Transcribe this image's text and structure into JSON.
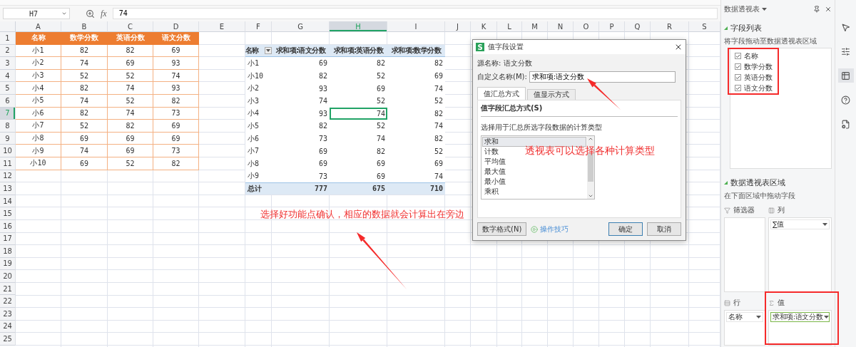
{
  "formula_bar": {
    "cell_ref": "H7",
    "fx": "fx",
    "value": "74"
  },
  "sheet": {
    "columns": [
      {
        "label": "A",
        "selected": false
      },
      {
        "label": "B",
        "selected": false
      },
      {
        "label": "C",
        "selected": false
      },
      {
        "label": "D",
        "selected": false
      },
      {
        "label": "E",
        "selected": false
      },
      {
        "label": "F",
        "selected": false
      },
      {
        "label": "G",
        "selected": false
      },
      {
        "label": "H",
        "selected": true
      },
      {
        "label": "I",
        "selected": false
      },
      {
        "label": "J",
        "selected": false
      },
      {
        "label": "K",
        "selected": false
      },
      {
        "label": "L",
        "selected": false
      },
      {
        "label": "M",
        "selected": false
      },
      {
        "label": "N",
        "selected": false
      },
      {
        "label": "O",
        "selected": false
      },
      {
        "label": "P",
        "selected": false
      },
      {
        "label": "Q",
        "selected": false
      },
      {
        "label": "R",
        "selected": false
      },
      {
        "label": "S",
        "selected": false
      }
    ],
    "rows": [
      {
        "label": "1",
        "selected": false
      },
      {
        "label": "2",
        "selected": false
      },
      {
        "label": "3",
        "selected": false
      },
      {
        "label": "4",
        "selected": false
      },
      {
        "label": "5",
        "selected": false
      },
      {
        "label": "6",
        "selected": false
      },
      {
        "label": "7",
        "selected": true
      },
      {
        "label": "8",
        "selected": false
      },
      {
        "label": "9",
        "selected": false
      },
      {
        "label": "10",
        "selected": false
      },
      {
        "label": "11",
        "selected": false
      },
      {
        "label": "12",
        "selected": false
      },
      {
        "label": "13",
        "selected": false
      },
      {
        "label": "14",
        "selected": false
      },
      {
        "label": "15",
        "selected": false
      },
      {
        "label": "16",
        "selected": false
      },
      {
        "label": "17",
        "selected": false
      },
      {
        "label": "18",
        "selected": false
      },
      {
        "label": "19",
        "selected": false
      },
      {
        "label": "20",
        "selected": false
      },
      {
        "label": "21",
        "selected": false
      },
      {
        "label": "22",
        "selected": false
      },
      {
        "label": "23",
        "selected": false
      },
      {
        "label": "24",
        "selected": false
      },
      {
        "label": "25",
        "selected": false
      }
    ],
    "source_table": {
      "header": [
        "名称",
        "数学分数",
        "英语分数",
        "语文分数"
      ],
      "rows": [
        [
          "小1",
          "82",
          "82",
          "69"
        ],
        [
          "小2",
          "74",
          "69",
          "93"
        ],
        [
          "小3",
          "52",
          "52",
          "74"
        ],
        [
          "小4",
          "82",
          "74",
          "93"
        ],
        [
          "小5",
          "74",
          "52",
          "82"
        ],
        [
          "小6",
          "82",
          "74",
          "73"
        ],
        [
          "小7",
          "52",
          "82",
          "69"
        ],
        [
          "小8",
          "69",
          "69",
          "69"
        ],
        [
          "小9",
          "74",
          "69",
          "73"
        ],
        [
          "小10",
          "69",
          "52",
          "82"
        ]
      ]
    },
    "pivot_table": {
      "header": [
        "名称",
        "求和项:语文分数",
        "求和项:英语分数",
        "求和项:数学分数"
      ],
      "rows": [
        [
          "小1",
          "69",
          "82",
          "82"
        ],
        [
          "小10",
          "82",
          "52",
          "69"
        ],
        [
          "小2",
          "93",
          "69",
          "74"
        ],
        [
          "小3",
          "74",
          "52",
          "52"
        ],
        [
          "小4",
          "93",
          "74",
          "82"
        ],
        [
          "小5",
          "82",
          "52",
          "74"
        ],
        [
          "小6",
          "73",
          "74",
          "82"
        ],
        [
          "小7",
          "69",
          "82",
          "52"
        ],
        [
          "小8",
          "69",
          "69",
          "69"
        ],
        [
          "小9",
          "73",
          "69",
          "74"
        ]
      ],
      "total": [
        "总计",
        "777",
        "675",
        "710"
      ]
    }
  },
  "dialog": {
    "app_icon_letter": "S",
    "title": "值字段设置",
    "source_name": "源名称: 语文分数",
    "custom_name_label": "自定义名称(M):",
    "custom_name_value": "求和项:语文分数",
    "tabs": [
      {
        "label": "值汇总方式",
        "selected": true
      },
      {
        "label": "值显示方式",
        "selected": false
      }
    ],
    "section_title": "值字段汇总方式(S)",
    "hint": "选择用于汇总所选字段数据的计算类型",
    "options": [
      {
        "label": "求和",
        "selected": true
      },
      {
        "label": "计数",
        "selected": false
      },
      {
        "label": "平均值",
        "selected": false
      },
      {
        "label": "最大值",
        "selected": false
      },
      {
        "label": "最小值",
        "selected": false
      },
      {
        "label": "乘积",
        "selected": false
      }
    ],
    "number_format_button": "数字格式(N)",
    "tips_link": "操作技巧",
    "ok_button": "确定",
    "cancel_button": "取消"
  },
  "pivot_panel": {
    "title": "数据透视表",
    "field_list_title": "字段列表",
    "field_list_hint": "将字段拖动至数据透视表区域",
    "fields": [
      {
        "label": "名称",
        "checked": true
      },
      {
        "label": "数学分数",
        "checked": true
      },
      {
        "label": "英语分数",
        "checked": true
      },
      {
        "label": "语文分数",
        "checked": true
      }
    ],
    "areas_title": "数据透视表区域",
    "areas_hint": "在下面区域中拖动字段",
    "areas": [
      {
        "kind": "filter",
        "label": "筛选器"
      },
      {
        "kind": "columns",
        "label": "列",
        "items": [
          "∑值"
        ]
      },
      {
        "kind": "rows",
        "label": "行",
        "items": [
          "名称"
        ]
      },
      {
        "kind": "values",
        "label": "值",
        "items": [
          "求和项:语文分数"
        ]
      }
    ]
  },
  "annotations": [
    "透视表可以选择各种计算类型",
    "选择好功能点确认，相应的数据就会计算出在旁边"
  ]
}
